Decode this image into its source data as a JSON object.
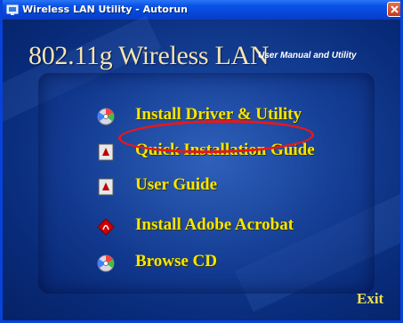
{
  "window": {
    "title": "Wireless LAN Utility - Autorun",
    "close_icon": "close-icon"
  },
  "header": {
    "title": "802.11g Wireless LAN",
    "subtitle": "User Manual and Utility"
  },
  "menu": {
    "items": [
      {
        "label": "Install Driver & Utility",
        "icon": "cd-icon"
      },
      {
        "label": "Quick Installation Guide",
        "icon": "pdf-document-icon"
      },
      {
        "label": "User Guide",
        "icon": "pdf-document-icon"
      },
      {
        "label": "Install Adobe Acrobat",
        "icon": "adobe-acrobat-icon"
      },
      {
        "label": "Browse CD",
        "icon": "cd-icon"
      }
    ]
  },
  "exit": {
    "label": "Exit"
  },
  "colors": {
    "accent": "#f8e600",
    "highlight": "#e81818",
    "background": "#0a2e8e"
  }
}
